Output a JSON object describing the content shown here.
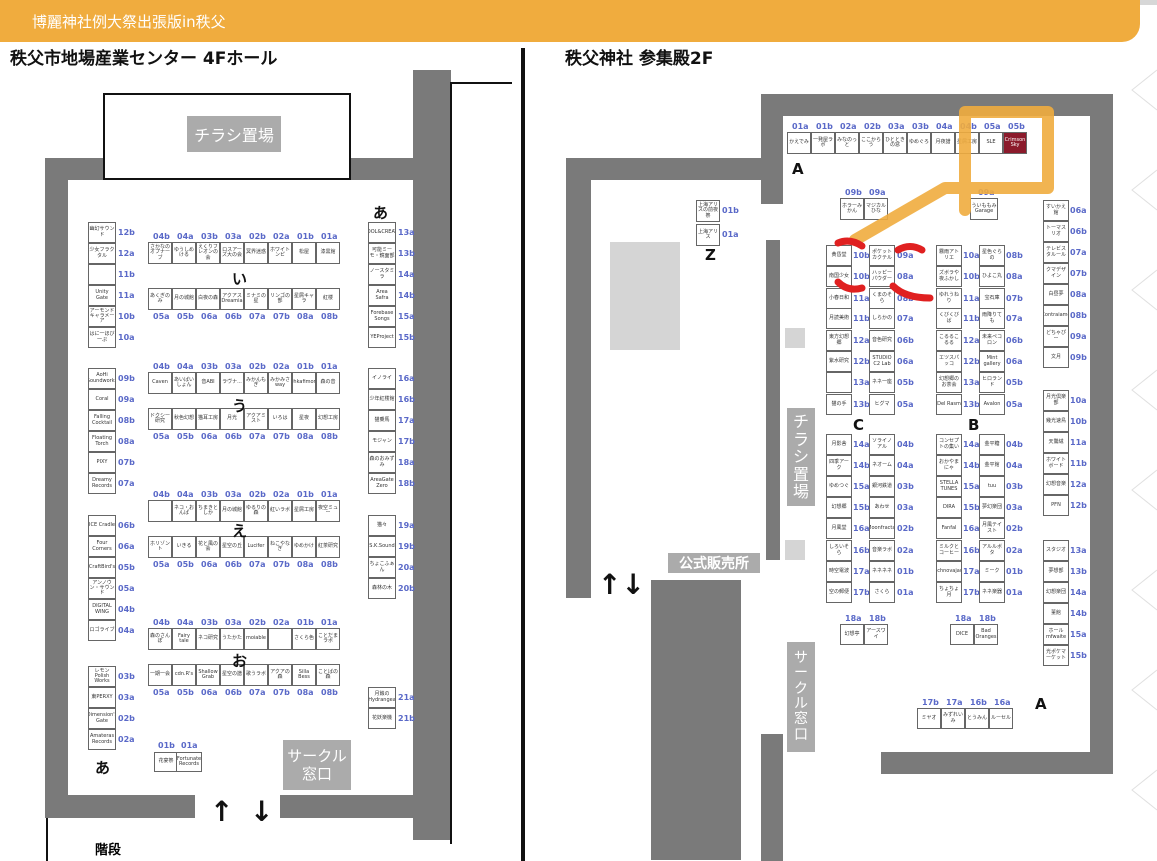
{
  "banner": {
    "title": "博麗神社例大祭出張版in秩父"
  },
  "left_hall": {
    "title": "秩父市地場産業センター 4Fホール",
    "flyer_sign": "チラシ置場",
    "circle_window": [
      "サークル",
      "窓口"
    ],
    "stairs": "階段",
    "arrows": [
      "↑",
      "↓"
    ],
    "row_labels": [
      "あ",
      "い",
      "う",
      "え",
      "お",
      "あ"
    ],
    "left_column": [
      {
        "name": "幽幻サウンド",
        "num": "12b"
      },
      {
        "name": "少女フラクタル",
        "num": "12a"
      },
      {
        "name": "",
        "num": "11b"
      },
      {
        "name": "Unity Gate",
        "num": "11a"
      },
      {
        "name": "アーモンドキャラメーア",
        "num": "10b"
      },
      {
        "name": "はに一ほび一ぷ",
        "num": "10a"
      },
      {
        "name": "AoHi Soundworks",
        "num": "09b"
      },
      {
        "name": "Coral",
        "num": "09a"
      },
      {
        "name": "Falling Cocktail",
        "num": "08b"
      },
      {
        "name": "Floating Torch",
        "num": "08a"
      },
      {
        "name": "PIXY",
        "num": "07b"
      },
      {
        "name": "Dreamy Records",
        "num": "07a"
      },
      {
        "name": "ICE Cradle",
        "num": "06b"
      },
      {
        "name": "Four Corners",
        "num": "06a"
      },
      {
        "name": "CraftBird's",
        "num": "05b"
      },
      {
        "name": "アンノウン・サウンド",
        "num": "05a"
      },
      {
        "name": "DIGITAL WING",
        "num": "04b"
      },
      {
        "name": "ロゴライブ",
        "num": "04a"
      },
      {
        "name": "レモン Polish Works",
        "num": "03b"
      },
      {
        "name": "東PERXY",
        "num": "03a"
      },
      {
        "name": "Dimension's Gate",
        "num": "02b"
      },
      {
        "name": "Amateras Records",
        "num": "02a"
      }
    ],
    "right_column": [
      {
        "name": "COOL&CREATE",
        "num": "13a"
      },
      {
        "name": "可能ミーモ・鏡面部",
        "num": "13b"
      },
      {
        "name": "ノースタミラ",
        "num": "14a"
      },
      {
        "name": "Area Safra",
        "num": "14b"
      },
      {
        "name": "Forebase Songs",
        "num": "15a"
      },
      {
        "name": "YEProject",
        "num": "15b"
      },
      {
        "name": "イノライ",
        "num": "16a"
      },
      {
        "name": "少年紅楼館",
        "num": "16b"
      },
      {
        "name": "猫乗馬",
        "num": "17a"
      },
      {
        "name": "モジャン",
        "num": "17b"
      },
      {
        "name": "森のおみずみ",
        "num": "18a"
      },
      {
        "name": "AreaGate Zero",
        "num": "18b"
      },
      {
        "name": "猫々",
        "num": "19a"
      },
      {
        "name": "S.K.Sound",
        "num": "19b"
      },
      {
        "name": "ちょこふぁん",
        "num": "20a"
      },
      {
        "name": "森林の木",
        "num": "20b"
      },
      {
        "name": "月蝕のHydrangea",
        "num": "21a"
      },
      {
        "name": "花妖楽機",
        "num": "21b"
      }
    ],
    "block_nums_top": [
      "04b",
      "04a",
      "03b",
      "03a",
      "02b",
      "02a",
      "01b",
      "01a"
    ],
    "block_nums_bottom": [
      "05a",
      "05b",
      "06a",
      "06b",
      "07a",
      "07b",
      "08a",
      "08b"
    ],
    "block_i_top": [
      "さかなのオプナーブ",
      "ゆうしめける",
      "えくりフレオンの会",
      "ロスアーズ大の会",
      "冥界迷惑",
      "ホワイトンピ",
      "松屋",
      "漆黒館"
    ],
    "block_i_bottom": [
      "あくぎのみ",
      "月の城館",
      "白夜の森",
      "アクアス Dreamia",
      "ミナミの星",
      "リンゴの部",
      "星屑キャラ",
      "紅楼"
    ],
    "block_u_top": [
      "Caven",
      "あいばいしょん",
      "音ABI",
      "ラヴナ...",
      "みかんもぎ",
      "みかみさ way",
      "Ohkafimory",
      "森の音"
    ],
    "block_u_bottom": [
      "ドクシー研究",
      "秋色幻想",
      "猫耳工房",
      "月光",
      "アクアミスト",
      "いろは",
      "星夜",
      "幻想工房"
    ],
    "block_e_top": [
      "",
      "ネコ・おんぱ",
      "ちまきとしか",
      "月の城館",
      "ゆるりの森",
      "紅いラボ",
      "星屑工房",
      "夜空ミュー"
    ],
    "block_e_bottom": [
      "ホリゾント",
      "いきる",
      "花と風の会",
      "星空の丘",
      "Lucifer",
      "ねこやなぎ",
      "ゆめかけ",
      "紅茶研究"
    ],
    "block_o_top": [
      "森のさんぽ",
      "Fairy tale",
      "ネコ研究",
      "うたかた",
      "moiable",
      "",
      "さくら色",
      "ことだまラボ"
    ],
    "block_o_bottom": [
      "一期一会",
      "cdn.R's",
      "Shallow Grab",
      "星空の譜",
      "歌うラボ",
      "アクアの森",
      "Silla Bess",
      "ことばの森"
    ],
    "entrance_nums": [
      "01b",
      "01a"
    ],
    "entrance_boxes": [
      "花宴祭",
      "Fortunate Records"
    ]
  },
  "right_hall": {
    "title": "秩父神社 参集殿2F",
    "flyer_sign": [
      "チ",
      "ラ",
      "シ",
      "置",
      "場"
    ],
    "official_shop": "公式販売所",
    "circle_window": [
      "サ",
      "ー",
      "ク",
      "ル",
      "窓",
      "口"
    ],
    "arrows": [
      "↑↓"
    ],
    "labels": [
      "A",
      "Z",
      "C",
      "B",
      "A"
    ],
    "top_nums": [
      "01a",
      "01b",
      "02a",
      "02b",
      "03a",
      "03b",
      "04a",
      "04b",
      "05a",
      "05b"
    ],
    "top_boxes": [
      "かえでみ",
      "一発屋ラボ",
      "みなのっと",
      "ここからう",
      "ひとときの窓",
      "ゆめぐろ",
      "月夜譜",
      "星屑工房",
      "SLE",
      "Crimson Sky"
    ],
    "z_boxes": [
      {
        "name": "上海アリスの前夜祭",
        "num": "01b"
      },
      {
        "name": "上海アリス",
        "num": "01a"
      }
    ],
    "upper_nums": [
      "09b",
      "09a",
      "09a"
    ],
    "upper_boxes": [
      "ホラーみかん",
      "マジカルひな",
      "ういももみ Garage"
    ],
    "c_left": [
      {
        "name": "黄昏堂",
        "num": "10b"
      },
      {
        "name": "南国少女",
        "num": "10b"
      },
      {
        "name": "小春日和",
        "num": "11a"
      },
      {
        "name": "月読美術",
        "num": "11b"
      },
      {
        "name": "東方幻想郷",
        "num": "12a"
      },
      {
        "name": "紫水研究",
        "num": "12b"
      },
      {
        "name": "",
        "num": "13a"
      },
      {
        "name": "猫の手",
        "num": "13b"
      }
    ],
    "c_mid": [
      {
        "name": "ポケットカクテル",
        "num": "09a"
      },
      {
        "name": "ハッピーパウダー",
        "num": "08a"
      },
      {
        "name": "くまのそら",
        "num": "08b"
      },
      {
        "name": "しらかの",
        "num": "07a"
      },
      {
        "name": "音色研究",
        "num": "06b"
      },
      {
        "name": "STUDIO C2 Lab",
        "num": "06a"
      },
      {
        "name": "ネネ一座",
        "num": "05b"
      },
      {
        "name": "ヒグマ",
        "num": "05a"
      }
    ],
    "b_left": [
      {
        "name": "霧雨アトリエ",
        "num": "10a"
      },
      {
        "name": "ズボラや夜ふかし",
        "num": "10b"
      },
      {
        "name": "ゆれうねり",
        "num": "11a"
      },
      {
        "name": "くびくびば",
        "num": "11b"
      },
      {
        "name": "こるるこるる",
        "num": "12a"
      },
      {
        "name": "エツスパッコ",
        "num": "12b"
      },
      {
        "name": "幻想郷のお茶会",
        "num": "13a"
      },
      {
        "name": "Del Rasm",
        "num": "13b"
      }
    ],
    "b_right": [
      {
        "name": "星色ぐらの",
        "num": "08b"
      },
      {
        "name": "ひよこ丸",
        "num": "08a"
      },
      {
        "name": "宝石庫",
        "num": "07b"
      },
      {
        "name": "雨降りても",
        "num": "07a"
      },
      {
        "name": "未来ペコロン",
        "num": "06b"
      },
      {
        "name": "Mint gallery",
        "num": "06a"
      },
      {
        "name": "ヒロランド",
        "num": "05b"
      },
      {
        "name": "Avalon",
        "num": "05a"
      }
    ],
    "far_right": [
      {
        "name": "すいかえ館",
        "num": "06a"
      },
      {
        "name": "トーマスリオ",
        "num": "06b"
      },
      {
        "name": "テレビスタルール",
        "num": "07a"
      },
      {
        "name": "クマデザイン",
        "num": "07b"
      },
      {
        "name": "白昼夢",
        "num": "08a"
      },
      {
        "name": "Contraiamo",
        "num": "08b"
      },
      {
        "name": "どちゃぴー",
        "num": "09a"
      },
      {
        "name": "文月",
        "num": "09b"
      },
      {
        "name": "月光倶楽部",
        "num": "10a"
      },
      {
        "name": "幾光速鳥",
        "num": "10b"
      },
      {
        "name": "天鵞絨",
        "num": "11a"
      },
      {
        "name": "ホワイトボード",
        "num": "11b"
      },
      {
        "name": "幻想音楽",
        "num": "12a"
      },
      {
        "name": "PFN",
        "num": "12b"
      },
      {
        "name": "スタジオ",
        "num": "13a"
      },
      {
        "name": "夢想部",
        "num": "13b"
      },
      {
        "name": "幻想楽団",
        "num": "14a"
      },
      {
        "name": "菫館",
        "num": "14b"
      },
      {
        "name": "ホールmfwaite",
        "num": "15a"
      },
      {
        "name": "光ポケマーケット",
        "num": "15b"
      }
    ],
    "c_lower_left": [
      {
        "name": "月影舎",
        "num": "14a"
      },
      {
        "name": "四季アーク",
        "num": "14b"
      },
      {
        "name": "ゆめつぐ",
        "num": "15a"
      },
      {
        "name": "幻想郷",
        "num": "15b"
      },
      {
        "name": "月風堂",
        "num": "16a"
      },
      {
        "name": "しろいそら",
        "num": "16b"
      },
      {
        "name": "時空電波",
        "num": "17a"
      },
      {
        "name": "空の郵便",
        "num": "17b"
      }
    ],
    "c_lower_mid": [
      {
        "name": "ソライノアル",
        "num": "04b"
      },
      {
        "name": "ネオーム",
        "num": "04a"
      },
      {
        "name": "銀河鉄道",
        "num": "03b"
      },
      {
        "name": "あわせ",
        "num": "03a"
      },
      {
        "name": "Moonfractal",
        "num": "02b"
      },
      {
        "name": "音楽ラボ",
        "num": "02a"
      },
      {
        "name": "ネネネネ",
        "num": "01b"
      },
      {
        "name": "さくら",
        "num": "01a"
      }
    ],
    "b_lower_left": [
      {
        "name": "コンセプトの集い",
        "num": "14a"
      },
      {
        "name": "おかやまにゃ",
        "num": "14b"
      },
      {
        "name": "STELLA TUNES",
        "num": "15a"
      },
      {
        "name": "DIRA",
        "num": "15b"
      },
      {
        "name": "Fanfal",
        "num": "16a"
      },
      {
        "name": "ミルクとコーヒー",
        "num": "16b"
      },
      {
        "name": "Technovajade",
        "num": "17a"
      },
      {
        "name": "ちょちょ月",
        "num": "17b"
      }
    ],
    "b_lower_right": [
      {
        "name": "金平糖",
        "num": "04b"
      },
      {
        "name": "金平館",
        "num": "04a"
      },
      {
        "name": "tuu",
        "num": "03b"
      },
      {
        "name": "夢幻楽団",
        "num": "03a"
      },
      {
        "name": "月風テイスト",
        "num": "02b"
      },
      {
        "name": "アルルボタ",
        "num": "02a"
      },
      {
        "name": "ミーク",
        "num": "01b"
      },
      {
        "name": "ネネ楽器",
        "num": "01a"
      }
    ],
    "bottom_pairs": [
      {
        "nums": [
          "18a",
          "18b"
        ],
        "boxes": [
          "幻想亭",
          "アースワイ"
        ]
      },
      {
        "nums": [
          "18a",
          "18b"
        ],
        "boxes": [
          "DICE",
          "Bad Oranges"
        ]
      },
      {
        "nums": [
          "17b",
          "17a",
          "16b",
          "16a"
        ],
        "boxes": [
          "ミヤオ",
          "みずれいみ",
          "とうみん",
          "ルーセル"
        ]
      }
    ]
  },
  "colors": {
    "banner": "#f0ac3e",
    "wall": "#7a7a7a",
    "number": "#5a69c8",
    "highlight": "#8b1a2b",
    "mark_red": "#e02020",
    "mark_orange": "#f0ac3e"
  }
}
